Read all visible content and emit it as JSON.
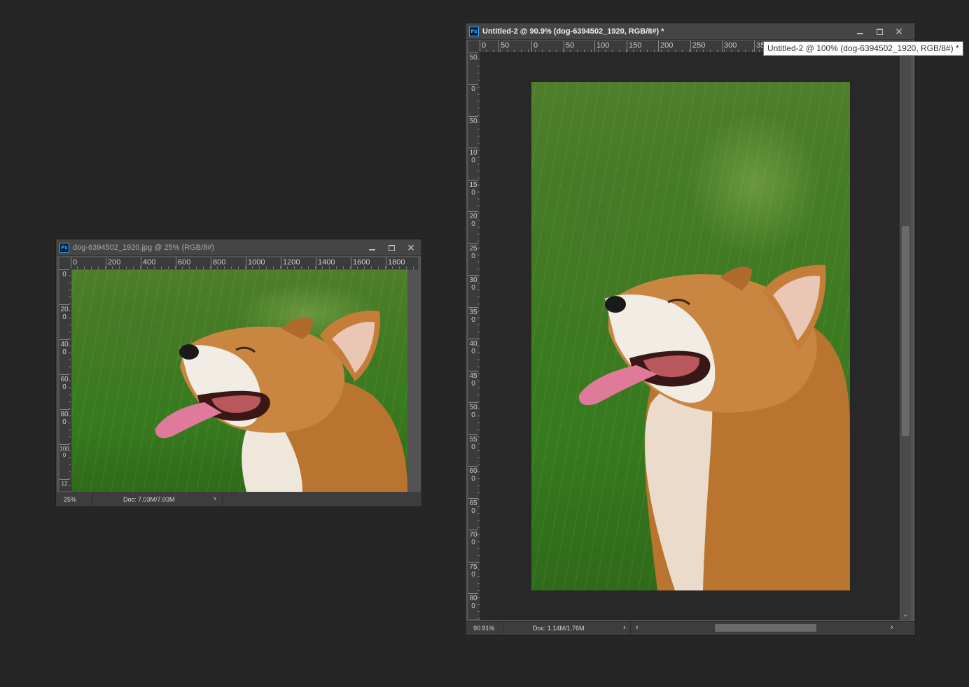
{
  "left_window": {
    "title": "dog-6394502_1920.jpg @ 25% (RGB/8#)",
    "app_icon": "Ps",
    "ruler_h": [
      "0",
      "200",
      "400",
      "600",
      "800",
      "1000",
      "1200",
      "1400",
      "1600",
      "1800"
    ],
    "ruler_v": [
      "0",
      "200",
      "400",
      "600",
      "800",
      "1000",
      "12"
    ],
    "zoom": "25%",
    "doc_size": "Doc: 7.03M/7.03M",
    "image_alt": "Corgi dog with tongue out on green grass"
  },
  "right_window": {
    "title": "Untitled-2 @ 90.9% (dog-6394502_1920, RGB/8#) *",
    "app_icon": "Ps",
    "ruler_h": [
      "0",
      "50",
      "0",
      "50",
      "100",
      "150",
      "200",
      "250",
      "300",
      "35"
    ],
    "ruler_v": [
      "50",
      "0",
      "50",
      "100",
      "150",
      "200",
      "250",
      "300",
      "350",
      "400",
      "450",
      "500",
      "550",
      "600",
      "650",
      "700",
      "750",
      "800"
    ],
    "zoom": "90.91%",
    "doc_size": "Doc: 1.14M/1.76M",
    "image_alt": "Cropped corgi dog image on green grass"
  },
  "tooltip": {
    "text": "Untitled-2 @ 100% (dog-6394502_1920, RGB/8#) *"
  },
  "icons": {
    "minimize": "minimize-icon",
    "maximize": "maximize-icon",
    "close": "close-icon",
    "close_glyph": "✕",
    "status_arrow": "›",
    "scroll_left": "‹",
    "scroll_right": "›",
    "scroll_down": "⌄"
  },
  "colors": {
    "workspace": "#262626",
    "window": "#535353",
    "titlebar": "#454545",
    "ps_blue": "#31a8ff"
  }
}
